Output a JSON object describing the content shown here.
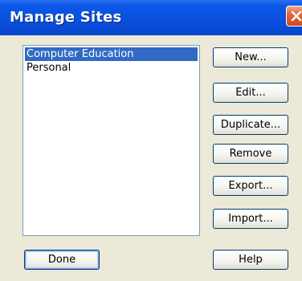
{
  "window": {
    "title": "Manage Sites"
  },
  "sites": {
    "items": [
      {
        "label": "Computer Education",
        "selected": true
      },
      {
        "label": "Personal",
        "selected": false
      }
    ]
  },
  "buttons": {
    "new": "New...",
    "edit": "Edit...",
    "duplicate": "Duplicate...",
    "remove": "Remove",
    "export": "Export...",
    "import": "Import...",
    "done": "Done",
    "help": "Help"
  },
  "colors": {
    "titlebar": "#0a4fdc",
    "selection": "#316ac5",
    "dialog_bg": "#ece9d8",
    "close_button": "#e0693d"
  },
  "icons": {
    "close": "close-icon"
  }
}
